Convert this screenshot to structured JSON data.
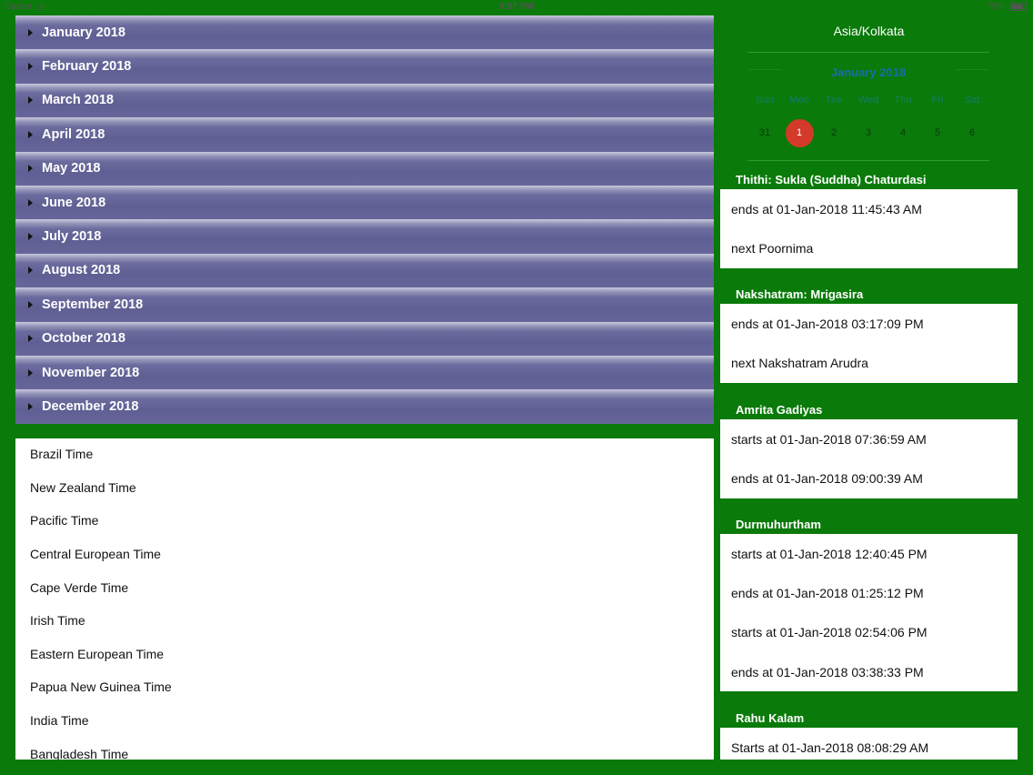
{
  "status_bar": {
    "carrier": "Carrier",
    "time": "9:57 PM",
    "battery": "76%"
  },
  "months": [
    "January 2018",
    "February 2018",
    "March 2018",
    "April 2018",
    "May 2018",
    "June 2018",
    "July 2018",
    "August 2018",
    "September 2018",
    "October 2018",
    "November 2018",
    "December 2018"
  ],
  "timezones": [
    "Brazil Time",
    "New Zealand Time",
    "Pacific Time",
    "Central European Time",
    "Cape Verde Time",
    "Irish Time",
    "Eastern European Time",
    "Papua New Guinea Time",
    "India Time",
    "Bangladesh Time"
  ],
  "right": {
    "timezone": "Asia/Kolkata",
    "calendar": {
      "month": "January 2018",
      "weekdays": [
        "Sun",
        "Mon",
        "Tue",
        "Wed",
        "Thu",
        "Fri",
        "Sat"
      ],
      "days": [
        "31",
        "1",
        "2",
        "3",
        "4",
        "5",
        "6"
      ],
      "selected_day": "1"
    },
    "sections": [
      {
        "title": "Thithi: Sukla (Suddha) Chaturdasi",
        "rows": [
          "ends at 01-Jan-2018 11:45:43 AM",
          "next Poornima"
        ]
      },
      {
        "title": "Nakshatram: Mrigasira",
        "rows": [
          "ends at 01-Jan-2018 03:17:09 PM",
          "next Nakshatram Arudra"
        ]
      },
      {
        "title": "Amrita Gadiyas",
        "rows": [
          "starts at 01-Jan-2018 07:36:59 AM",
          "ends at 01-Jan-2018 09:00:39 AM"
        ]
      },
      {
        "title": "Durmuhurtham",
        "rows": [
          "starts at 01-Jan-2018 12:40:45 PM",
          "ends at 01-Jan-2018 01:25:12 PM",
          "starts at 01-Jan-2018 02:54:06 PM",
          "ends at 01-Jan-2018 03:38:33 PM"
        ]
      },
      {
        "title": "Rahu Kalam",
        "rows": [
          "Starts at 01-Jan-2018 08:08:29 AM"
        ]
      }
    ]
  },
  "colors": {
    "background": "#0a7a0a",
    "selected_day": "#d33a2a",
    "month_bar": "#5f5f94"
  }
}
